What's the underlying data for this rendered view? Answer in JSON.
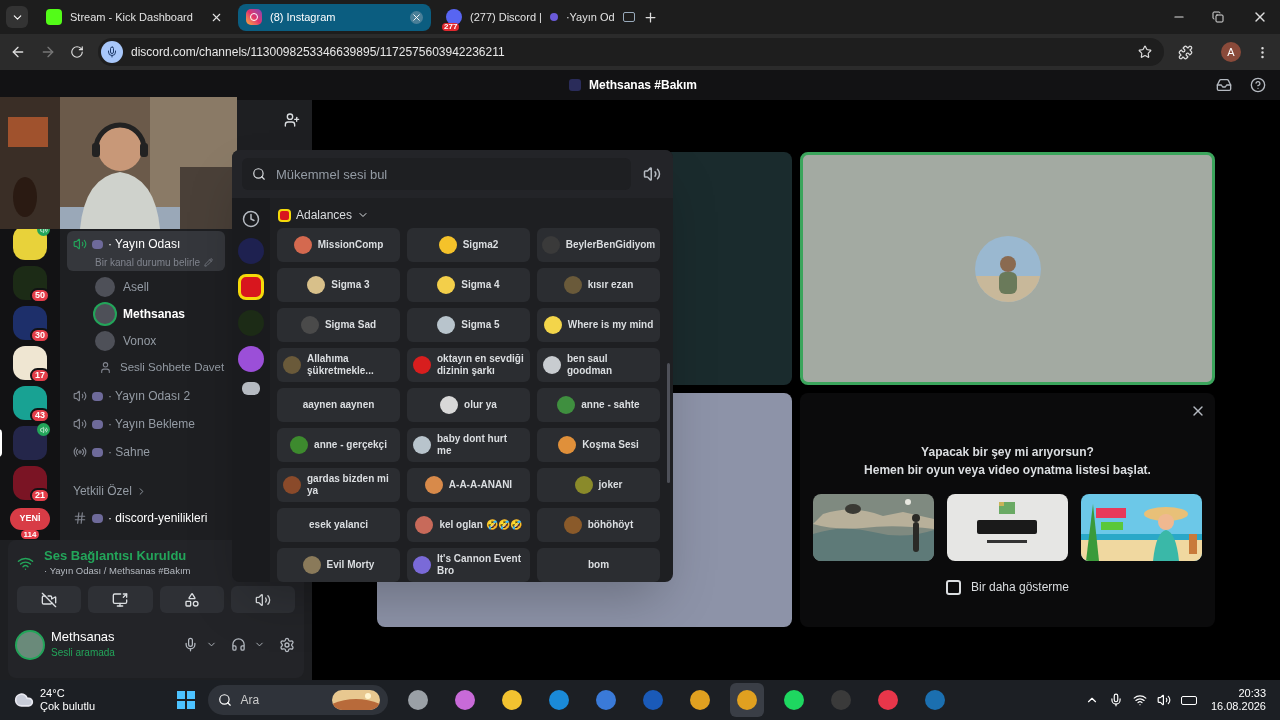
{
  "browser": {
    "tabs": [
      {
        "kind": "kick",
        "title": "Stream - Kick Dashboard",
        "selected": false
      },
      {
        "kind": "instagram",
        "title": "(8) Instagram",
        "selected": true
      },
      {
        "kind": "discord",
        "title": "(277) Discord |",
        "title_rest": "·Yayın Od",
        "badge": "277",
        "selected": false
      }
    ],
    "url": "discord.com/channels/1130098253346639895/1172575603942236211",
    "profile": "A"
  },
  "topbar": {
    "title": "Methsanas #Bakım"
  },
  "servers": [
    {
      "color": "#e8d23a",
      "speaking": true,
      "selected": false
    },
    {
      "color": "#1c2b16",
      "badge": "50",
      "selected": false
    },
    {
      "color": "#1d2f6a",
      "badge": "30",
      "selected": false
    },
    {
      "color": "#efe6d2",
      "badge": "17",
      "selected": false
    },
    {
      "color": "#18a293",
      "badge": "43",
      "selected": false
    },
    {
      "color": "#24264a",
      "speaking": true,
      "selected": true
    },
    {
      "color": "#7a1424",
      "badge": "21",
      "selected": false
    }
  ],
  "new_pill": {
    "label": "YENİ",
    "badge": "114"
  },
  "channels": [
    {
      "kind": "voice",
      "name": "· Yayın Odası",
      "status": "Bir kanal durumu belirle",
      "selected": true,
      "connected": true,
      "users": [
        {
          "name": "Asell",
          "speaking": false
        },
        {
          "name": "Methsanas",
          "speaking": true
        },
        {
          "name": "Vonox",
          "speaking": false
        }
      ],
      "invite": "Sesli Sohbete Davet"
    },
    {
      "kind": "voice",
      "name": "· Yayın Odası 2",
      "selected": false,
      "connected": false
    },
    {
      "kind": "voice",
      "name": "· Yayın Bekleme",
      "selected": false,
      "connected": false
    },
    {
      "kind": "stage",
      "name": "· Sahne",
      "selected": false
    },
    {
      "kind": "category",
      "name": "Yetkili Özel"
    },
    {
      "kind": "text",
      "name": "· discord-yenilikleri",
      "selected": false,
      "unread": true
    }
  ],
  "voice_panel": {
    "status": "Ses Bağlantısı Kuruldu",
    "location": "· Yayın Odası / Methsanas #Bakım"
  },
  "user": {
    "name": "Methsanas",
    "status": "Sesli aramada"
  },
  "soundboard": {
    "placeholder": "Mükemmel sesi bul",
    "servers": [
      {
        "kind": "recent"
      },
      {
        "kind": "server",
        "color": "#1e2150",
        "selected": false
      },
      {
        "kind": "server",
        "color": "#d8161e",
        "selected": true
      },
      {
        "kind": "server",
        "color": "#1c2b16",
        "selected": false
      },
      {
        "kind": "server",
        "color": "#9b4fd8",
        "selected": false
      },
      {
        "kind": "discord"
      }
    ],
    "category": "Adalances",
    "sounds": [
      {
        "name": "MissionComp",
        "color": "#d4694f"
      },
      {
        "name": "Sigma2",
        "color": "#f5c22a"
      },
      {
        "name": "BeylerBenGidiyom",
        "color": "#3a3a3a"
      },
      {
        "name": "Sigma 3",
        "color": "#d8c08a"
      },
      {
        "name": "Sigma 4",
        "color": "#f3cf4a"
      },
      {
        "name": "kısır ezan",
        "color": "#6a5a3a"
      },
      {
        "name": "Sigma Sad",
        "color": "#4a4a4a"
      },
      {
        "name": "Sigma 5",
        "color": "#b8c4cc"
      },
      {
        "name": "Where is my mind",
        "color": "#f3d54a"
      },
      {
        "name": "Allahıma şükretmekle...",
        "color": "#6a5a3a"
      },
      {
        "name": "oktayın en sevdiği dizinin şarkı",
        "color": "#d81e1e"
      },
      {
        "name": "ben saul goodman",
        "color": "#c8ccd0"
      },
      {
        "name": "aaynen aaynen"
      },
      {
        "name": "olur ya",
        "color": "#d8d8d8"
      },
      {
        "name": "anne - sahte",
        "color": "#3f8f3f"
      },
      {
        "name": "anne - gerçekçi",
        "color": "#3d8a2e"
      },
      {
        "name": "baby dont hurt me",
        "color": "#b8c4cc"
      },
      {
        "name": "Koşma Sesi",
        "color": "#e0903a"
      },
      {
        "name": "gardas bizden mi ya",
        "color": "#8a4a2a"
      },
      {
        "name": "A-A-A-ANANI",
        "color": "#d88a4a"
      },
      {
        "name": "joker",
        "color": "#8a8a2a"
      },
      {
        "name": "esek yalanci"
      },
      {
        "name": "kel oglan 🤣🤣🤣",
        "color": "#c86a5a"
      },
      {
        "name": "böhöhöyt",
        "color": "#8a5a2a"
      },
      {
        "name": "Evil Morty",
        "color": "#8a7a5a"
      },
      {
        "name": "It's Cannon Event Bro",
        "color": "#7a6ad8"
      },
      {
        "name": "bom"
      }
    ]
  },
  "tiles": [
    {
      "kind": "empty",
      "color": "#1a2b2d",
      "speaking": false
    },
    {
      "kind": "avatar",
      "color": "#a3aaa2",
      "speaking": true
    },
    {
      "kind": "empty",
      "color": "#8d93a8",
      "speaking": false
    }
  ],
  "activity": {
    "title": "Yapacak bir şey mi arıyorsun?",
    "subtitle": "Hemen bir oyun veya video oynatma listesi başlat.",
    "dont_show": {
      "label": "Bir daha gösterme",
      "checked": false
    }
  },
  "taskbar": {
    "weather": {
      "temp": "24°C",
      "condition": "Çok bulutlu"
    },
    "search": {
      "placeholder": "Ara"
    },
    "apps": [
      {
        "color": "#9aa0a6",
        "active": false
      },
      {
        "color": "#c86ad8",
        "active": false
      },
      {
        "color": "#f2c230",
        "active": false
      },
      {
        "color": "#1a8ad8",
        "active": false
      },
      {
        "color": "#3a7ad8",
        "active": false
      },
      {
        "color": "#1a5ab8",
        "active": false
      },
      {
        "color": "#e0a020",
        "active": false
      },
      {
        "color": "#e0a020",
        "active": true
      },
      {
        "color": "#1ed760",
        "active": false
      },
      {
        "color": "#3a3a3a",
        "active": false
      },
      {
        "color": "#e8364a",
        "active": false
      },
      {
        "color": "#1b6fb0",
        "active": false
      }
    ],
    "time": "20:33",
    "date": "16.08.2026"
  }
}
